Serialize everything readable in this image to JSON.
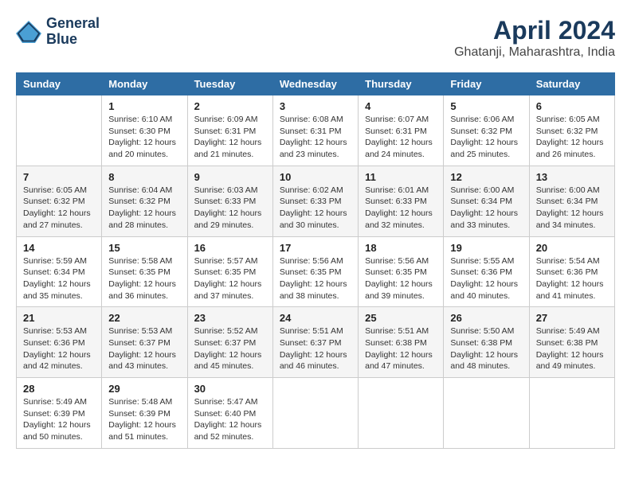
{
  "logo": {
    "line1": "General",
    "line2": "Blue"
  },
  "title": "April 2024",
  "subtitle": "Ghatanji, Maharashtra, India",
  "weekdays": [
    "Sunday",
    "Monday",
    "Tuesday",
    "Wednesday",
    "Thursday",
    "Friday",
    "Saturday"
  ],
  "weeks": [
    [
      {
        "day": "",
        "sunrise": "",
        "sunset": "",
        "daylight": ""
      },
      {
        "day": "1",
        "sunrise": "Sunrise: 6:10 AM",
        "sunset": "Sunset: 6:30 PM",
        "daylight": "Daylight: 12 hours and 20 minutes."
      },
      {
        "day": "2",
        "sunrise": "Sunrise: 6:09 AM",
        "sunset": "Sunset: 6:31 PM",
        "daylight": "Daylight: 12 hours and 21 minutes."
      },
      {
        "day": "3",
        "sunrise": "Sunrise: 6:08 AM",
        "sunset": "Sunset: 6:31 PM",
        "daylight": "Daylight: 12 hours and 23 minutes."
      },
      {
        "day": "4",
        "sunrise": "Sunrise: 6:07 AM",
        "sunset": "Sunset: 6:31 PM",
        "daylight": "Daylight: 12 hours and 24 minutes."
      },
      {
        "day": "5",
        "sunrise": "Sunrise: 6:06 AM",
        "sunset": "Sunset: 6:32 PM",
        "daylight": "Daylight: 12 hours and 25 minutes."
      },
      {
        "day": "6",
        "sunrise": "Sunrise: 6:05 AM",
        "sunset": "Sunset: 6:32 PM",
        "daylight": "Daylight: 12 hours and 26 minutes."
      }
    ],
    [
      {
        "day": "7",
        "sunrise": "Sunrise: 6:05 AM",
        "sunset": "Sunset: 6:32 PM",
        "daylight": "Daylight: 12 hours and 27 minutes."
      },
      {
        "day": "8",
        "sunrise": "Sunrise: 6:04 AM",
        "sunset": "Sunset: 6:32 PM",
        "daylight": "Daylight: 12 hours and 28 minutes."
      },
      {
        "day": "9",
        "sunrise": "Sunrise: 6:03 AM",
        "sunset": "Sunset: 6:33 PM",
        "daylight": "Daylight: 12 hours and 29 minutes."
      },
      {
        "day": "10",
        "sunrise": "Sunrise: 6:02 AM",
        "sunset": "Sunset: 6:33 PM",
        "daylight": "Daylight: 12 hours and 30 minutes."
      },
      {
        "day": "11",
        "sunrise": "Sunrise: 6:01 AM",
        "sunset": "Sunset: 6:33 PM",
        "daylight": "Daylight: 12 hours and 32 minutes."
      },
      {
        "day": "12",
        "sunrise": "Sunrise: 6:00 AM",
        "sunset": "Sunset: 6:34 PM",
        "daylight": "Daylight: 12 hours and 33 minutes."
      },
      {
        "day": "13",
        "sunrise": "Sunrise: 6:00 AM",
        "sunset": "Sunset: 6:34 PM",
        "daylight": "Daylight: 12 hours and 34 minutes."
      }
    ],
    [
      {
        "day": "14",
        "sunrise": "Sunrise: 5:59 AM",
        "sunset": "Sunset: 6:34 PM",
        "daylight": "Daylight: 12 hours and 35 minutes."
      },
      {
        "day": "15",
        "sunrise": "Sunrise: 5:58 AM",
        "sunset": "Sunset: 6:35 PM",
        "daylight": "Daylight: 12 hours and 36 minutes."
      },
      {
        "day": "16",
        "sunrise": "Sunrise: 5:57 AM",
        "sunset": "Sunset: 6:35 PM",
        "daylight": "Daylight: 12 hours and 37 minutes."
      },
      {
        "day": "17",
        "sunrise": "Sunrise: 5:56 AM",
        "sunset": "Sunset: 6:35 PM",
        "daylight": "Daylight: 12 hours and 38 minutes."
      },
      {
        "day": "18",
        "sunrise": "Sunrise: 5:56 AM",
        "sunset": "Sunset: 6:35 PM",
        "daylight": "Daylight: 12 hours and 39 minutes."
      },
      {
        "day": "19",
        "sunrise": "Sunrise: 5:55 AM",
        "sunset": "Sunset: 6:36 PM",
        "daylight": "Daylight: 12 hours and 40 minutes."
      },
      {
        "day": "20",
        "sunrise": "Sunrise: 5:54 AM",
        "sunset": "Sunset: 6:36 PM",
        "daylight": "Daylight: 12 hours and 41 minutes."
      }
    ],
    [
      {
        "day": "21",
        "sunrise": "Sunrise: 5:53 AM",
        "sunset": "Sunset: 6:36 PM",
        "daylight": "Daylight: 12 hours and 42 minutes."
      },
      {
        "day": "22",
        "sunrise": "Sunrise: 5:53 AM",
        "sunset": "Sunset: 6:37 PM",
        "daylight": "Daylight: 12 hours and 43 minutes."
      },
      {
        "day": "23",
        "sunrise": "Sunrise: 5:52 AM",
        "sunset": "Sunset: 6:37 PM",
        "daylight": "Daylight: 12 hours and 45 minutes."
      },
      {
        "day": "24",
        "sunrise": "Sunrise: 5:51 AM",
        "sunset": "Sunset: 6:37 PM",
        "daylight": "Daylight: 12 hours and 46 minutes."
      },
      {
        "day": "25",
        "sunrise": "Sunrise: 5:51 AM",
        "sunset": "Sunset: 6:38 PM",
        "daylight": "Daylight: 12 hours and 47 minutes."
      },
      {
        "day": "26",
        "sunrise": "Sunrise: 5:50 AM",
        "sunset": "Sunset: 6:38 PM",
        "daylight": "Daylight: 12 hours and 48 minutes."
      },
      {
        "day": "27",
        "sunrise": "Sunrise: 5:49 AM",
        "sunset": "Sunset: 6:38 PM",
        "daylight": "Daylight: 12 hours and 49 minutes."
      }
    ],
    [
      {
        "day": "28",
        "sunrise": "Sunrise: 5:49 AM",
        "sunset": "Sunset: 6:39 PM",
        "daylight": "Daylight: 12 hours and 50 minutes."
      },
      {
        "day": "29",
        "sunrise": "Sunrise: 5:48 AM",
        "sunset": "Sunset: 6:39 PM",
        "daylight": "Daylight: 12 hours and 51 minutes."
      },
      {
        "day": "30",
        "sunrise": "Sunrise: 5:47 AM",
        "sunset": "Sunset: 6:40 PM",
        "daylight": "Daylight: 12 hours and 52 minutes."
      },
      {
        "day": "",
        "sunrise": "",
        "sunset": "",
        "daylight": ""
      },
      {
        "day": "",
        "sunrise": "",
        "sunset": "",
        "daylight": ""
      },
      {
        "day": "",
        "sunrise": "",
        "sunset": "",
        "daylight": ""
      },
      {
        "day": "",
        "sunrise": "",
        "sunset": "",
        "daylight": ""
      }
    ]
  ]
}
